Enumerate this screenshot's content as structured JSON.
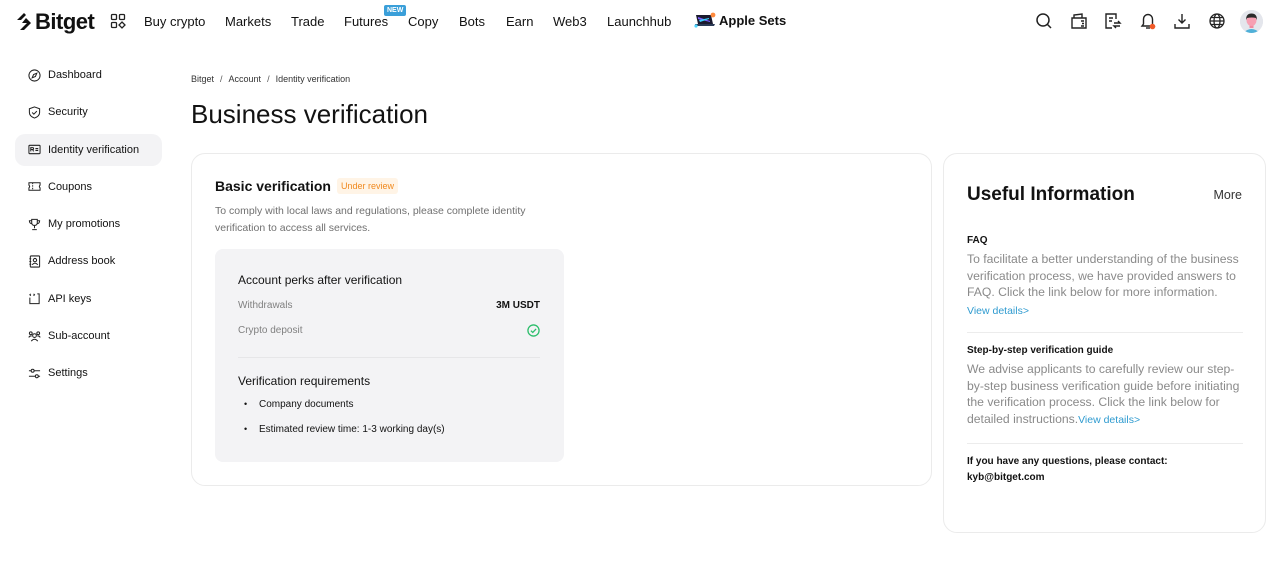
{
  "header": {
    "logo_text": "Bitget",
    "nav": [
      {
        "label": "Buy crypto"
      },
      {
        "label": "Markets"
      },
      {
        "label": "Trade"
      },
      {
        "label": "Futures",
        "badge": "NEW"
      },
      {
        "label": "Copy"
      },
      {
        "label": "Bots"
      },
      {
        "label": "Earn"
      },
      {
        "label": "Web3"
      },
      {
        "label": "Launchhub"
      }
    ],
    "promo_label": "Apple Sets",
    "icons": [
      "search-icon",
      "wallet-icon",
      "orders-icon",
      "bell-icon",
      "download-icon",
      "globe-icon",
      "avatar"
    ],
    "accent_badge_color": "#3a9fd9",
    "notification_dot_color": "#f05a28"
  },
  "sidebar": {
    "items": [
      {
        "label": "Dashboard",
        "icon": "compass-icon"
      },
      {
        "label": "Security",
        "icon": "shield-icon"
      },
      {
        "label": "Identity verification",
        "icon": "id-card-icon",
        "active": true
      },
      {
        "label": "Coupons",
        "icon": "ticket-icon"
      },
      {
        "label": "My promotions",
        "icon": "trophy-icon"
      },
      {
        "label": "Address book",
        "icon": "address-book-icon"
      },
      {
        "label": "API keys",
        "icon": "api-key-icon"
      },
      {
        "label": "Sub-account",
        "icon": "users-icon"
      },
      {
        "label": "Settings",
        "icon": "sliders-icon"
      }
    ]
  },
  "breadcrumb": {
    "items": [
      "Bitget",
      "Account",
      "Identity verification"
    ],
    "separator": "/"
  },
  "page": {
    "title": "Business verification"
  },
  "basic": {
    "title": "Basic verification",
    "status": "Under review",
    "status_color": "#f0891e",
    "description": "To comply with local laws and regulations, please complete identity verification to access all services.",
    "perks": {
      "title": "Account perks after verification",
      "rows": [
        {
          "label": "Withdrawals",
          "value": "3M USDT"
        },
        {
          "label": "Crypto deposit",
          "value_icon": "check-circle-icon",
          "value_color": "#2dbe6c"
        }
      ]
    },
    "requirements": {
      "title": "Verification requirements",
      "items": [
        "Company documents",
        "Estimated review time: 1-3 working day(s)"
      ]
    }
  },
  "useful": {
    "title": "Useful Information",
    "more_label": "More",
    "faq": {
      "heading": "FAQ",
      "body": "To facilitate a better understanding of the business verification process, we have provided answers to FAQ. Click the link below for more information.",
      "link": "View details>"
    },
    "guide": {
      "heading": "Step-by-step verification guide",
      "body": "We advise applicants to carefully review our step-by-step business verification guide before initiating the verification process. Click the link below for detailed instructions.",
      "link": "View details>"
    },
    "contact_text": "If you have any questions, please contact:",
    "contact_email": "kyb@bitget.com",
    "link_color": "#2f9bd0"
  }
}
